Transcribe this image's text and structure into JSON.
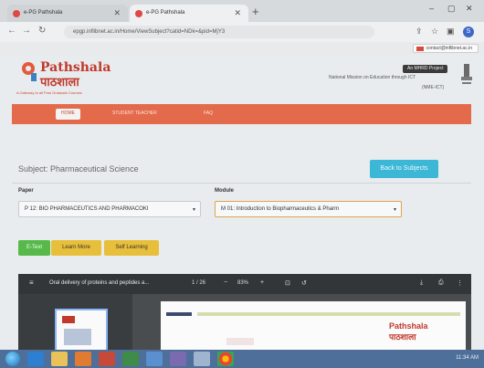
{
  "browser": {
    "tabs": [
      {
        "label": "e-PG Pathshala",
        "active": false
      },
      {
        "label": "e-PG Pathshala",
        "active": true
      }
    ],
    "new_tab": "+",
    "window_controls": [
      "–",
      "▢",
      "✕"
    ],
    "url": "epgp.inflibnet.ac.in/Home/ViewSubject?catid=NDk=&pid=MjY3",
    "notification": "contact@inflibnet.ac.in",
    "avatar_letter": "S"
  },
  "site": {
    "logo_top": "Pathshala",
    "logo_hindi": "पाठशाला",
    "logo_tagline": "A Gateway to all Post Graduate Courses",
    "project_button": "An MHRD Project",
    "nme_text": "National Mission on Education through ICT",
    "nme_sub": "(NME-ICT)",
    "nav": {
      "home": "HOME",
      "items": [
        "STUDENT TEACHER",
        "FAQ"
      ]
    },
    "subject": "Subject: Pharmaceutical Science",
    "back_button": "Back to Subjects",
    "paper_label": "Paper",
    "paper_value": "P 12: BIO PHARMACEUTICS AND PHARMACOKI",
    "module_label": "Module",
    "module_value": "M 01: Introduction to Biopharmaceutics & Pharm",
    "buttons": {
      "etext": "E-Text",
      "learn": "Learn More",
      "self": "Self Learning"
    }
  },
  "viewer": {
    "title": "Oral delivery of proteins and peptides a...",
    "page": "1 / 26",
    "zoom": "83%",
    "page_logo_top": "Pathshala",
    "page_logo_hindi": "पाठशाला"
  },
  "taskbar": {
    "clock": "11:34 AM"
  },
  "colors": {
    "nav_strip": "#e36a4a",
    "back_button": "#3db7d6",
    "etext_button": "#56b94a",
    "yellow_button": "#e8bf3a",
    "logo_red": "#c0392b"
  },
  "icons": [
    "back-arrow-icon",
    "forward-arrow-icon",
    "reload-icon",
    "star-icon",
    "extensions-icon",
    "menu-icon",
    "download-icon",
    "print-icon",
    "more-icon"
  ]
}
